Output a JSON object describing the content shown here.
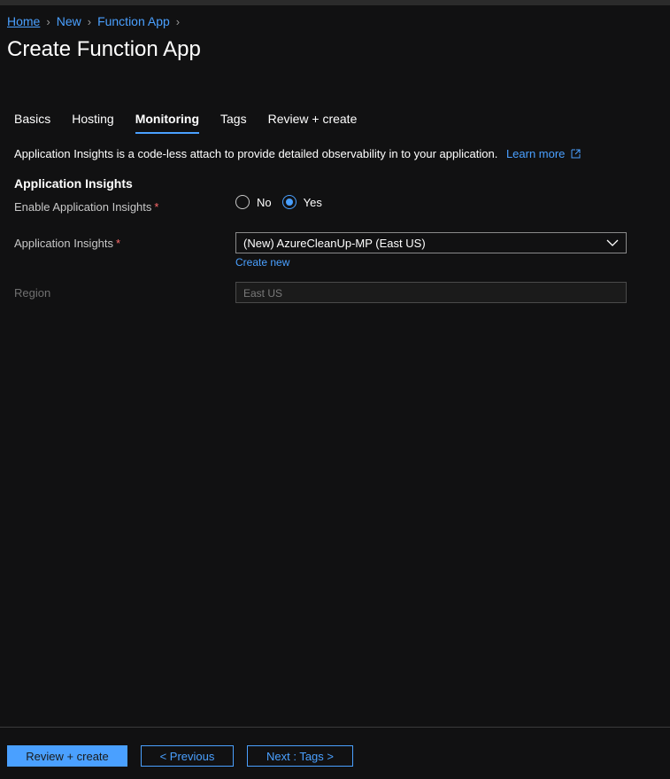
{
  "breadcrumb": {
    "items": [
      "Home",
      "New",
      "Function App"
    ]
  },
  "page": {
    "title": "Create Function App"
  },
  "tabs": [
    {
      "label": "Basics"
    },
    {
      "label": "Hosting"
    },
    {
      "label": "Monitoring",
      "active": true
    },
    {
      "label": "Tags"
    },
    {
      "label": "Review + create"
    }
  ],
  "description": {
    "text": "Application Insights is a code-less attach to provide detailed observability in to your application.",
    "learn_more": "Learn more"
  },
  "section": {
    "title": "Application Insights"
  },
  "form": {
    "enable_label": "Enable Application Insights",
    "required_mark": "*",
    "options": {
      "no": "No",
      "yes": "Yes"
    },
    "selected_option": "Yes",
    "insights_label": "Application Insights",
    "insights_value": "(New) AzureCleanUp-MP (East US)",
    "create_new": "Create new",
    "region_label": "Region",
    "region_value": "East US"
  },
  "footer": {
    "review_create": "Review + create",
    "previous": "< Previous",
    "next": "Next : Tags >"
  },
  "colors": {
    "accent": "#4aa0ff",
    "background": "#111112",
    "required": "#ff6b6b"
  }
}
